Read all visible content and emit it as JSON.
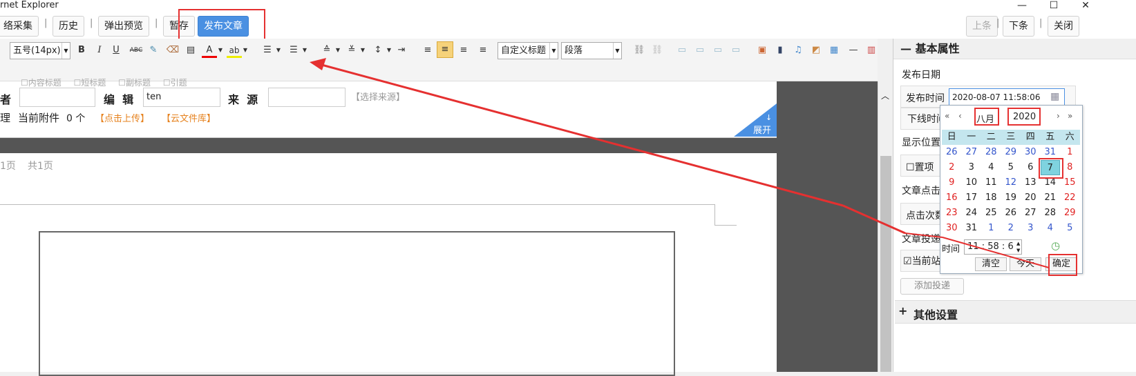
{
  "window": {
    "title": "rnet Explorer",
    "min": "—",
    "max": "☐",
    "close": "✕"
  },
  "topbar": {
    "buttons": [
      "络采集",
      "历史",
      "弹出预览",
      "暂存",
      "发布文章"
    ],
    "right_buttons": [
      "上条",
      "下条",
      "关闭"
    ],
    "sep": "|"
  },
  "toolbar": {
    "font_size": "五号(14px)",
    "bold": "B",
    "italic": "I",
    "underline": "U",
    "strike": "ABC",
    "font_color": "A",
    "highlight": "ab",
    "heading": "自定义标题",
    "paragraph": "段落"
  },
  "form": {
    "hidden_labels": [
      "内容标题",
      "短标题",
      "副标题",
      "引题"
    ],
    "author_label": "者",
    "editor_label": "编  辑",
    "editor_value": "ten",
    "source_label": "来  源",
    "source_link": "【选择来源】",
    "attach_label": "理",
    "attach_text": "当前附件",
    "attach_count": "0 个",
    "upload_link": "【点击上传】",
    "cloud_link": "【云文件库】",
    "expand": "展开",
    "expand_arrow": "↓"
  },
  "pager": {
    "current": "1页",
    "total": "共1页"
  },
  "panel": {
    "basic": "基本属性",
    "publish_date": "发布日期",
    "publish_time_label": "发布时间",
    "publish_time_value": "2020-08-07 11:58:06",
    "offline_label": "下线时间",
    "display_pos": "显示位置",
    "pin": "置项",
    "clicks_label": "文章点击",
    "clicks_field": "点击次数",
    "deliver_label": "文章投递",
    "current_site": "当前站",
    "add_deliver": "添加投递",
    "other": "其他设置",
    "collapse": "—",
    "expand": "+"
  },
  "calendar": {
    "month": "八月",
    "year": "2020",
    "weekdays": [
      "日",
      "一",
      "二",
      "三",
      "四",
      "五",
      "六"
    ],
    "weeks": [
      [
        "26",
        "27",
        "28",
        "29",
        "30",
        "31",
        "1"
      ],
      [
        "2",
        "3",
        "4",
        "5",
        "6",
        "7",
        "8"
      ],
      [
        "9",
        "10",
        "11",
        "12",
        "13",
        "14",
        "15"
      ],
      [
        "16",
        "17",
        "18",
        "19",
        "20",
        "21",
        "22"
      ],
      [
        "23",
        "24",
        "25",
        "26",
        "27",
        "28",
        "29"
      ],
      [
        "30",
        "31",
        "1",
        "2",
        "3",
        "4",
        "5"
      ]
    ],
    "time_label": "时间",
    "hour": "11",
    "minute": "58",
    "second": "6",
    "colon": ":",
    "clear": "清空",
    "today": "今天",
    "ok": "确定",
    "nav": [
      "«",
      "‹",
      "›",
      "»"
    ]
  },
  "colors": {
    "accent": "#4a90e2",
    "annotation": "#e53030",
    "orange": "#e6821e"
  }
}
